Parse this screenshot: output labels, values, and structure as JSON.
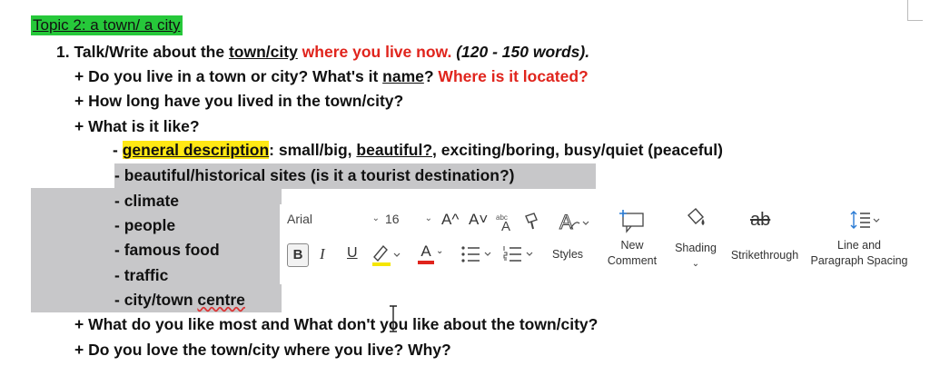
{
  "topic": "Topic 2: a town/ a city",
  "task": {
    "number": "1.",
    "part1": "Talk/Write about the ",
    "part2": "town/city",
    "part3": " where you live now.",
    "part4": " (120 - 150 words)."
  },
  "q1": {
    "part1": "+ Do you live in a town or city? What's it ",
    "part2": "name",
    "part3": "? ",
    "part4": "Where is it located?"
  },
  "q2": "+ How long have you lived in the town/city?",
  "q3": "+ What is it like?",
  "items": {
    "general": {
      "prefix": "- ",
      "label": "general description",
      "rest": ": small/big, ",
      "beautiful": "beautiful?,",
      "rest2": " exciting/boring, busy/quiet (peaceful)"
    },
    "sites": "- beautiful/historical sites (is it a tourist destination?)",
    "climate": "- climate",
    "people": "- people",
    "food": "- famous food",
    "traffic": "- traffic",
    "centre": {
      "prefix": "- city/town ",
      "word": "centre"
    }
  },
  "q4": {
    "part1": "+ What do you like most and What d",
    "part2": "on't you like about the town/city?"
  },
  "q5": "+ Do you love the town/city where you live? Why?",
  "toolbar": {
    "font": "Arial",
    "size": "16",
    "bold": "B",
    "italic": "I",
    "underline": "U",
    "grow": "A^",
    "shrink": "A˅",
    "styles": "Styles",
    "new_comment_1": "New",
    "new_comment_2": "Comment",
    "shading": "Shading",
    "strikethrough": "Strikethrough",
    "strike_icon_text": "ab",
    "spacing_1": "Line and",
    "spacing_2": "Paragraph Spacing",
    "font_color_letter": "A",
    "colors": {
      "highlight": "#f5e600",
      "font": "#e0241c"
    }
  }
}
